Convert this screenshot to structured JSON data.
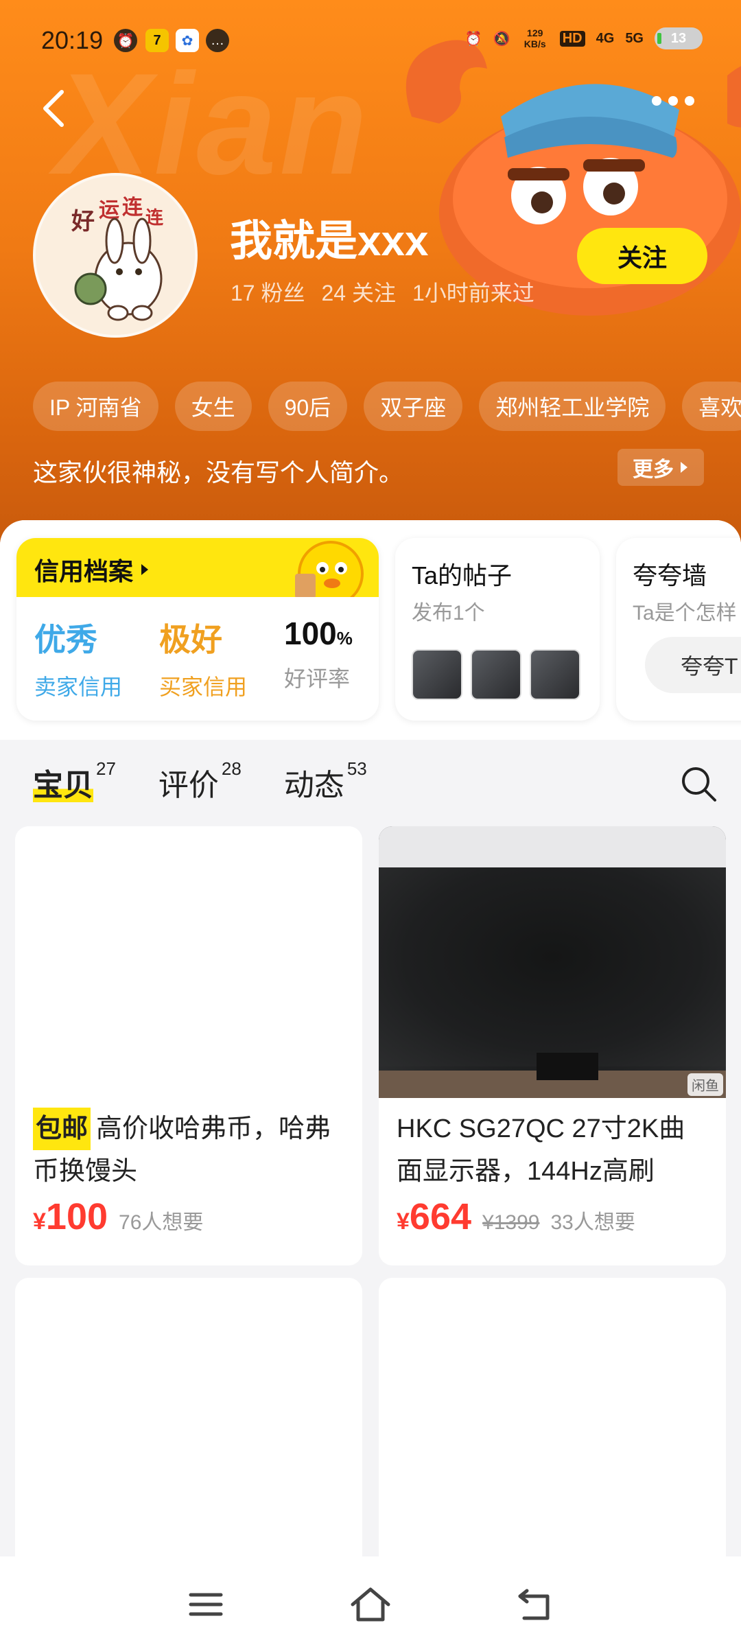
{
  "status_bar": {
    "time": "20:19",
    "net_speed": "129 KB/s",
    "signal1": "4G",
    "signal2": "5G",
    "hd": "HD",
    "battery": "13"
  },
  "profile": {
    "watermark": "Xian",
    "username": "我就是xxx",
    "followers": "17 粉丝",
    "following": "24 关注",
    "last_seen": "1小时前来过",
    "follow_label": "关注",
    "tags": [
      "IP 河南省",
      "女生",
      "90后",
      "双子座",
      "郑州轻工业学院",
      "喜欢"
    ],
    "bio": "这家伙很神秘，没有写个人简介。",
    "more_label": "更多"
  },
  "credit": {
    "title": "信用档案",
    "seller_value": "优秀",
    "seller_label": "卖家信用",
    "buyer_value": "极好",
    "buyer_label": "买家信用",
    "rate_value": "100",
    "rate_unit": "%",
    "rate_label": "好评率"
  },
  "posts": {
    "title": "Ta的帖子",
    "subtitle": "发布1个"
  },
  "praise": {
    "title": "夸夸墙",
    "subtitle": "Ta是个怎样",
    "button": "夸夸T"
  },
  "tabs": [
    {
      "label": "宝贝",
      "count": "27"
    },
    {
      "label": "评价",
      "count": "28"
    },
    {
      "label": "动态",
      "count": "53"
    }
  ],
  "items": [
    {
      "badge": "包邮",
      "title": "高价收哈弗币，哈弗币换馒头",
      "currency": "¥",
      "price": "100",
      "wants": "76人想要"
    },
    {
      "title": "HKC SG27QC 27寸2K曲面显示器，144Hz高刷",
      "currency": "¥",
      "price": "664",
      "old_price": "¥1399",
      "wants": "33人想要",
      "photo_tag": "闲鱼"
    }
  ],
  "colors": {
    "accent_yellow": "#ffe60f",
    "header_orange": "#f07a14",
    "price_red": "#ff3b30",
    "seller_blue": "#3fa9e8",
    "buyer_orange": "#f0a020"
  }
}
